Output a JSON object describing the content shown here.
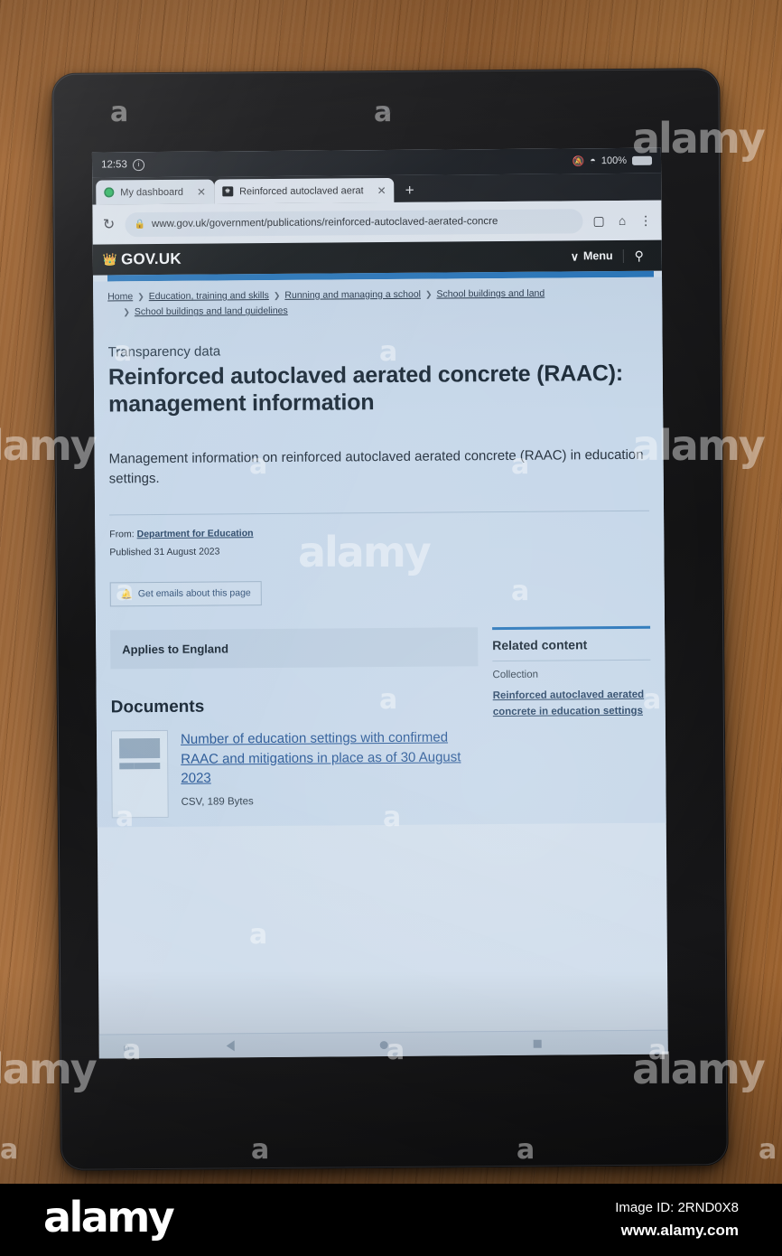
{
  "device": {
    "statusbar": {
      "time": "12:53",
      "info_icon": "info-icon",
      "mute_icon": "bell-muted-icon",
      "wifi_icon": "wifi-icon",
      "battery_percent": "100%",
      "battery_icon": "battery-full-icon"
    },
    "navbar": {
      "home_icon": "house-icon",
      "back_icon": "back-triangle-icon",
      "circle_icon": "home-circle-icon",
      "recents_icon": "recents-square-icon"
    }
  },
  "browser": {
    "tabs": [
      {
        "label": "My dashboard",
        "favicon": "green-circle-favicon",
        "close": "✕",
        "active": false
      },
      {
        "label": "Reinforced autoclaved aerat",
        "favicon": "govuk-crown-favicon",
        "close": "✕",
        "active": true
      }
    ],
    "new_tab_label": "+",
    "reload_icon": "↻",
    "lock_icon": "ὑ2",
    "url": "www.gov.uk/government/publications/reinforced-autoclaved-aerated-concre",
    "bookmark_icon": "bookmark-icon",
    "home_icon": "home-icon",
    "menu_icon": "⋮"
  },
  "govuk": {
    "brand": "GOV.UK",
    "crown_icon": "crown-icon",
    "menu_label": "Menu",
    "menu_chevron": "∨",
    "search_icon": "search-icon",
    "accent_blue": "#1d70b8",
    "header_black": "#0b0c0c"
  },
  "breadcrumbs": [
    "Home",
    "Education, training and skills",
    "Running and managing a school",
    "School buildings and land",
    "School buildings and land guidelines"
  ],
  "article": {
    "type": "Transparency data",
    "title": "Reinforced autoclaved aerated concrete (RAAC): management information",
    "description": "Management information on reinforced autoclaved aerated concrete (RAAC) in education settings.",
    "from_label": "From:",
    "from_org": "Department for Education",
    "published_label": "Published",
    "published_date": "31 August 2023",
    "email_button": "Get emails about this page",
    "email_button_icon": "bell-icon",
    "applies_to": "Applies to England"
  },
  "documents": {
    "heading": "Documents",
    "items": [
      {
        "title": "Number of education settings with confirmed RAAC and mitigations in place as of 30 August 2023",
        "meta": "CSV, 189 Bytes",
        "icon": "csv-spreadsheet-icon"
      }
    ]
  },
  "related": {
    "heading": "Related content",
    "subheading": "Collection",
    "links": [
      "Reinforced autoclaved aerated concrete in education settings"
    ]
  },
  "watermark": {
    "text": "alamy",
    "letter": "a"
  },
  "footer": {
    "logo": "alamy",
    "image_id": "Image ID: 2RND0X8",
    "url": "www.alamy.com"
  }
}
